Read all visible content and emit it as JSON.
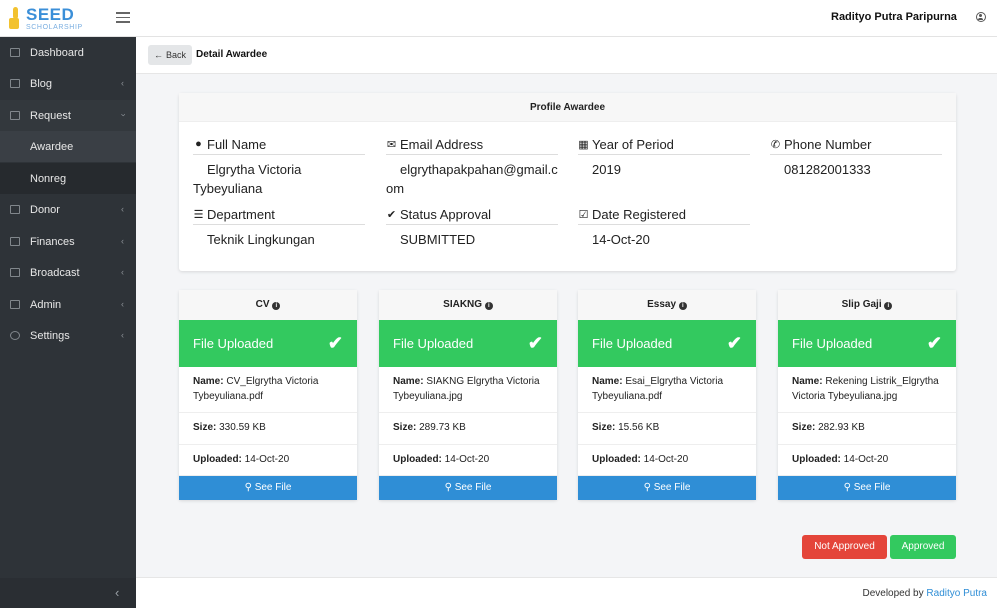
{
  "brand": {
    "title": "SEED",
    "subtitle": "SCHOLARSHIP"
  },
  "header": {
    "user_name": "Radityo Putra Paripurna"
  },
  "sidebar": {
    "items": [
      {
        "label": "Dashboard",
        "icon": "chart-icon"
      },
      {
        "label": "Blog",
        "icon": "edit-icon"
      },
      {
        "label": "Request",
        "icon": "user-plus-icon"
      },
      {
        "label": "Donor",
        "icon": "users-icon"
      },
      {
        "label": "Finances",
        "icon": "money-icon"
      },
      {
        "label": "Broadcast",
        "icon": "envelope-icon"
      },
      {
        "label": "Admin",
        "icon": "lock-icon"
      },
      {
        "label": "Settings",
        "icon": "gear-icon"
      }
    ],
    "submenu": [
      {
        "label": "Awardee"
      },
      {
        "label": "Nonreg"
      }
    ]
  },
  "breadcrumb": {
    "back_label": "Back",
    "title": "Detail Awardee"
  },
  "profile": {
    "heading": "Profile Awardee",
    "full_name_label": "Full Name",
    "full_name": "Elgrytha Victoria Tybeyuliana",
    "email_label": "Email Address",
    "email": "elgrythapakpahan@gmail.com",
    "year_label": "Year of Period",
    "year": "2019",
    "phone_label": "Phone Number",
    "phone": "081282001333",
    "department_label": "Department",
    "department": "Teknik Lingkungan",
    "status_label": "Status Approval",
    "status": "SUBMITTED",
    "date_label": "Date Registered",
    "date": "14-Oct-20"
  },
  "files": [
    {
      "title": "CV",
      "status": "File Uploaded",
      "name": "CV_Elgrytha Victoria Tybeyuliana.pdf",
      "size": "330.59 KB",
      "uploaded": "14-Oct-20",
      "button": "See File"
    },
    {
      "title": "SIAKNG",
      "status": "File Uploaded",
      "name": "SIAKNG Elgrytha Victoria Tybeyuliana.jpg",
      "size": "289.73 KB",
      "uploaded": "14-Oct-20",
      "button": "See File"
    },
    {
      "title": "Essay",
      "status": "File Uploaded",
      "name": "Esai_Elgrytha Victoria Tybeyuliana.pdf",
      "size": "15.56 KB",
      "uploaded": "14-Oct-20",
      "button": "See File"
    },
    {
      "title": "Slip Gaji",
      "status": "File Uploaded",
      "name": "Rekening Listrik_Elgrytha Victoria Tybeyuliana.jpg",
      "size": "282.93 KB",
      "uploaded": "14-Oct-20",
      "button": "See File"
    }
  ],
  "labels": {
    "name": "Name:",
    "size": "Size:",
    "uploaded": "Uploaded:"
  },
  "actions": {
    "not_approved": "Not Approved",
    "approved": "Approved"
  },
  "footer": {
    "text": "Developed by",
    "author": "Radityo Putra"
  },
  "colors": {
    "success": "#33c95f",
    "danger": "#e4453a",
    "primary": "#2f8ed6",
    "sidebar": "#2e3338"
  }
}
